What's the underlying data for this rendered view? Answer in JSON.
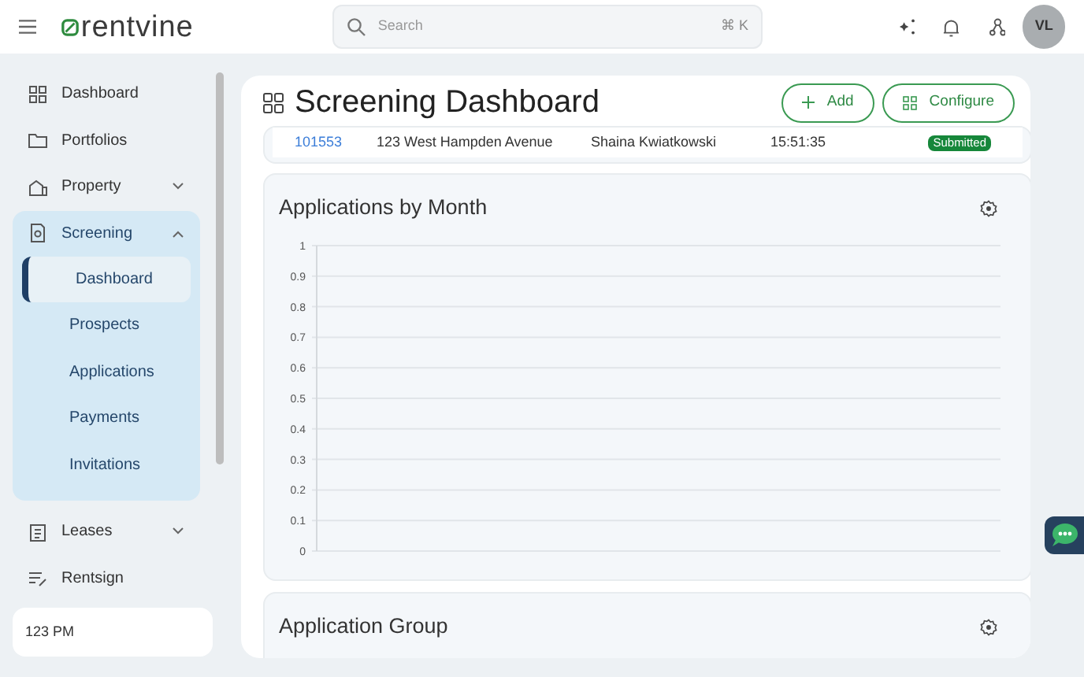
{
  "header": {
    "logo": "rentvine",
    "search": {
      "placeholder": "Search",
      "shortcut": "⌘ K"
    },
    "avatar": "VL"
  },
  "sidebar": {
    "items": [
      {
        "label": "Dashboard",
        "kind": "link"
      },
      {
        "label": "Portfolios",
        "kind": "link"
      },
      {
        "label": "Property",
        "kind": "group",
        "expanded": false
      },
      {
        "label": "Screening",
        "kind": "group",
        "expanded": true,
        "children": [
          {
            "label": "Dashboard",
            "selected": true
          },
          {
            "label": "Prospects",
            "selected": false
          },
          {
            "label": "Applications",
            "selected": false
          },
          {
            "label": "Payments",
            "selected": false
          },
          {
            "label": "Invitations",
            "selected": false
          }
        ]
      },
      {
        "label": "Leases",
        "kind": "group",
        "expanded": false
      },
      {
        "label": "Rentsign",
        "kind": "link"
      }
    ],
    "footer": "123 PM"
  },
  "page": {
    "title": "Screening Dashboard",
    "buttons": [
      {
        "label": "Add",
        "kind": "add"
      },
      {
        "label": "Configure",
        "kind": "configure"
      }
    ]
  },
  "table_row": {
    "id": "101553",
    "address": "123 West Hampden Avenue",
    "name": "Shaina Kwiatkowski",
    "time": "15:51:35",
    "status": "Submitted"
  },
  "cards": [
    {
      "title": "Applications by Month",
      "y_axis_labels": [
        "1",
        "0.9",
        "0.8",
        "0.7",
        "0.6",
        "0.5",
        "0.4",
        "0.3",
        "0.2",
        "0.1",
        "0"
      ]
    },
    {
      "title": "Application Group"
    }
  ]
}
